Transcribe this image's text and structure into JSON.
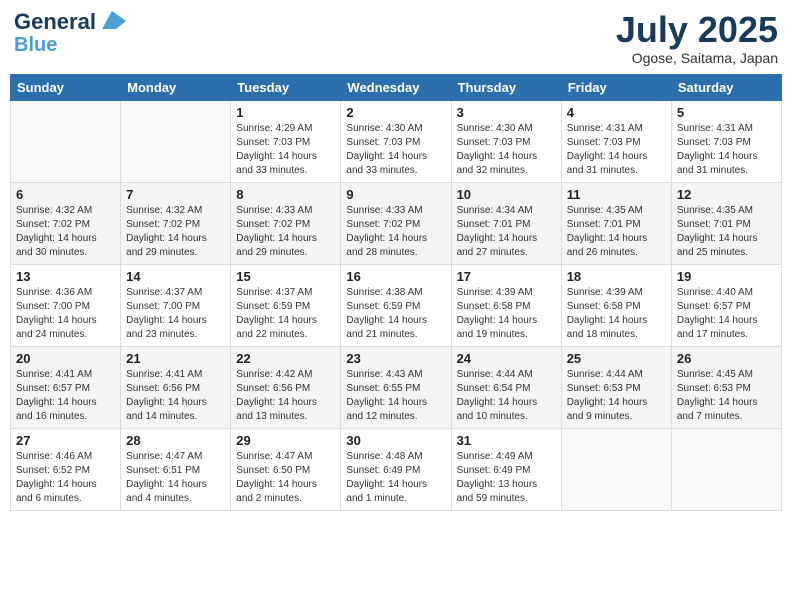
{
  "header": {
    "logo_line1": "General",
    "logo_line2": "Blue",
    "month": "July 2025",
    "location": "Ogose, Saitama, Japan"
  },
  "days_of_week": [
    "Sunday",
    "Monday",
    "Tuesday",
    "Wednesday",
    "Thursday",
    "Friday",
    "Saturday"
  ],
  "weeks": [
    [
      {
        "day": "",
        "sunrise": "",
        "sunset": "",
        "daylight": ""
      },
      {
        "day": "",
        "sunrise": "",
        "sunset": "",
        "daylight": ""
      },
      {
        "day": "1",
        "sunrise": "Sunrise: 4:29 AM",
        "sunset": "Sunset: 7:03 PM",
        "daylight": "Daylight: 14 hours and 33 minutes."
      },
      {
        "day": "2",
        "sunrise": "Sunrise: 4:30 AM",
        "sunset": "Sunset: 7:03 PM",
        "daylight": "Daylight: 14 hours and 33 minutes."
      },
      {
        "day": "3",
        "sunrise": "Sunrise: 4:30 AM",
        "sunset": "Sunset: 7:03 PM",
        "daylight": "Daylight: 14 hours and 32 minutes."
      },
      {
        "day": "4",
        "sunrise": "Sunrise: 4:31 AM",
        "sunset": "Sunset: 7:03 PM",
        "daylight": "Daylight: 14 hours and 31 minutes."
      },
      {
        "day": "5",
        "sunrise": "Sunrise: 4:31 AM",
        "sunset": "Sunset: 7:03 PM",
        "daylight": "Daylight: 14 hours and 31 minutes."
      }
    ],
    [
      {
        "day": "6",
        "sunrise": "Sunrise: 4:32 AM",
        "sunset": "Sunset: 7:02 PM",
        "daylight": "Daylight: 14 hours and 30 minutes."
      },
      {
        "day": "7",
        "sunrise": "Sunrise: 4:32 AM",
        "sunset": "Sunset: 7:02 PM",
        "daylight": "Daylight: 14 hours and 29 minutes."
      },
      {
        "day": "8",
        "sunrise": "Sunrise: 4:33 AM",
        "sunset": "Sunset: 7:02 PM",
        "daylight": "Daylight: 14 hours and 29 minutes."
      },
      {
        "day": "9",
        "sunrise": "Sunrise: 4:33 AM",
        "sunset": "Sunset: 7:02 PM",
        "daylight": "Daylight: 14 hours and 28 minutes."
      },
      {
        "day": "10",
        "sunrise": "Sunrise: 4:34 AM",
        "sunset": "Sunset: 7:01 PM",
        "daylight": "Daylight: 14 hours and 27 minutes."
      },
      {
        "day": "11",
        "sunrise": "Sunrise: 4:35 AM",
        "sunset": "Sunset: 7:01 PM",
        "daylight": "Daylight: 14 hours and 26 minutes."
      },
      {
        "day": "12",
        "sunrise": "Sunrise: 4:35 AM",
        "sunset": "Sunset: 7:01 PM",
        "daylight": "Daylight: 14 hours and 25 minutes."
      }
    ],
    [
      {
        "day": "13",
        "sunrise": "Sunrise: 4:36 AM",
        "sunset": "Sunset: 7:00 PM",
        "daylight": "Daylight: 14 hours and 24 minutes."
      },
      {
        "day": "14",
        "sunrise": "Sunrise: 4:37 AM",
        "sunset": "Sunset: 7:00 PM",
        "daylight": "Daylight: 14 hours and 23 minutes."
      },
      {
        "day": "15",
        "sunrise": "Sunrise: 4:37 AM",
        "sunset": "Sunset: 6:59 PM",
        "daylight": "Daylight: 14 hours and 22 minutes."
      },
      {
        "day": "16",
        "sunrise": "Sunrise: 4:38 AM",
        "sunset": "Sunset: 6:59 PM",
        "daylight": "Daylight: 14 hours and 21 minutes."
      },
      {
        "day": "17",
        "sunrise": "Sunrise: 4:39 AM",
        "sunset": "Sunset: 6:58 PM",
        "daylight": "Daylight: 14 hours and 19 minutes."
      },
      {
        "day": "18",
        "sunrise": "Sunrise: 4:39 AM",
        "sunset": "Sunset: 6:58 PM",
        "daylight": "Daylight: 14 hours and 18 minutes."
      },
      {
        "day": "19",
        "sunrise": "Sunrise: 4:40 AM",
        "sunset": "Sunset: 6:57 PM",
        "daylight": "Daylight: 14 hours and 17 minutes."
      }
    ],
    [
      {
        "day": "20",
        "sunrise": "Sunrise: 4:41 AM",
        "sunset": "Sunset: 6:57 PM",
        "daylight": "Daylight: 14 hours and 16 minutes."
      },
      {
        "day": "21",
        "sunrise": "Sunrise: 4:41 AM",
        "sunset": "Sunset: 6:56 PM",
        "daylight": "Daylight: 14 hours and 14 minutes."
      },
      {
        "day": "22",
        "sunrise": "Sunrise: 4:42 AM",
        "sunset": "Sunset: 6:56 PM",
        "daylight": "Daylight: 14 hours and 13 minutes."
      },
      {
        "day": "23",
        "sunrise": "Sunrise: 4:43 AM",
        "sunset": "Sunset: 6:55 PM",
        "daylight": "Daylight: 14 hours and 12 minutes."
      },
      {
        "day": "24",
        "sunrise": "Sunrise: 4:44 AM",
        "sunset": "Sunset: 6:54 PM",
        "daylight": "Daylight: 14 hours and 10 minutes."
      },
      {
        "day": "25",
        "sunrise": "Sunrise: 4:44 AM",
        "sunset": "Sunset: 6:53 PM",
        "daylight": "Daylight: 14 hours and 9 minutes."
      },
      {
        "day": "26",
        "sunrise": "Sunrise: 4:45 AM",
        "sunset": "Sunset: 6:53 PM",
        "daylight": "Daylight: 14 hours and 7 minutes."
      }
    ],
    [
      {
        "day": "27",
        "sunrise": "Sunrise: 4:46 AM",
        "sunset": "Sunset: 6:52 PM",
        "daylight": "Daylight: 14 hours and 6 minutes."
      },
      {
        "day": "28",
        "sunrise": "Sunrise: 4:47 AM",
        "sunset": "Sunset: 6:51 PM",
        "daylight": "Daylight: 14 hours and 4 minutes."
      },
      {
        "day": "29",
        "sunrise": "Sunrise: 4:47 AM",
        "sunset": "Sunset: 6:50 PM",
        "daylight": "Daylight: 14 hours and 2 minutes."
      },
      {
        "day": "30",
        "sunrise": "Sunrise: 4:48 AM",
        "sunset": "Sunset: 6:49 PM",
        "daylight": "Daylight: 14 hours and 1 minute."
      },
      {
        "day": "31",
        "sunrise": "Sunrise: 4:49 AM",
        "sunset": "Sunset: 6:49 PM",
        "daylight": "Daylight: 13 hours and 59 minutes."
      },
      {
        "day": "",
        "sunrise": "",
        "sunset": "",
        "daylight": ""
      },
      {
        "day": "",
        "sunrise": "",
        "sunset": "",
        "daylight": ""
      }
    ]
  ]
}
